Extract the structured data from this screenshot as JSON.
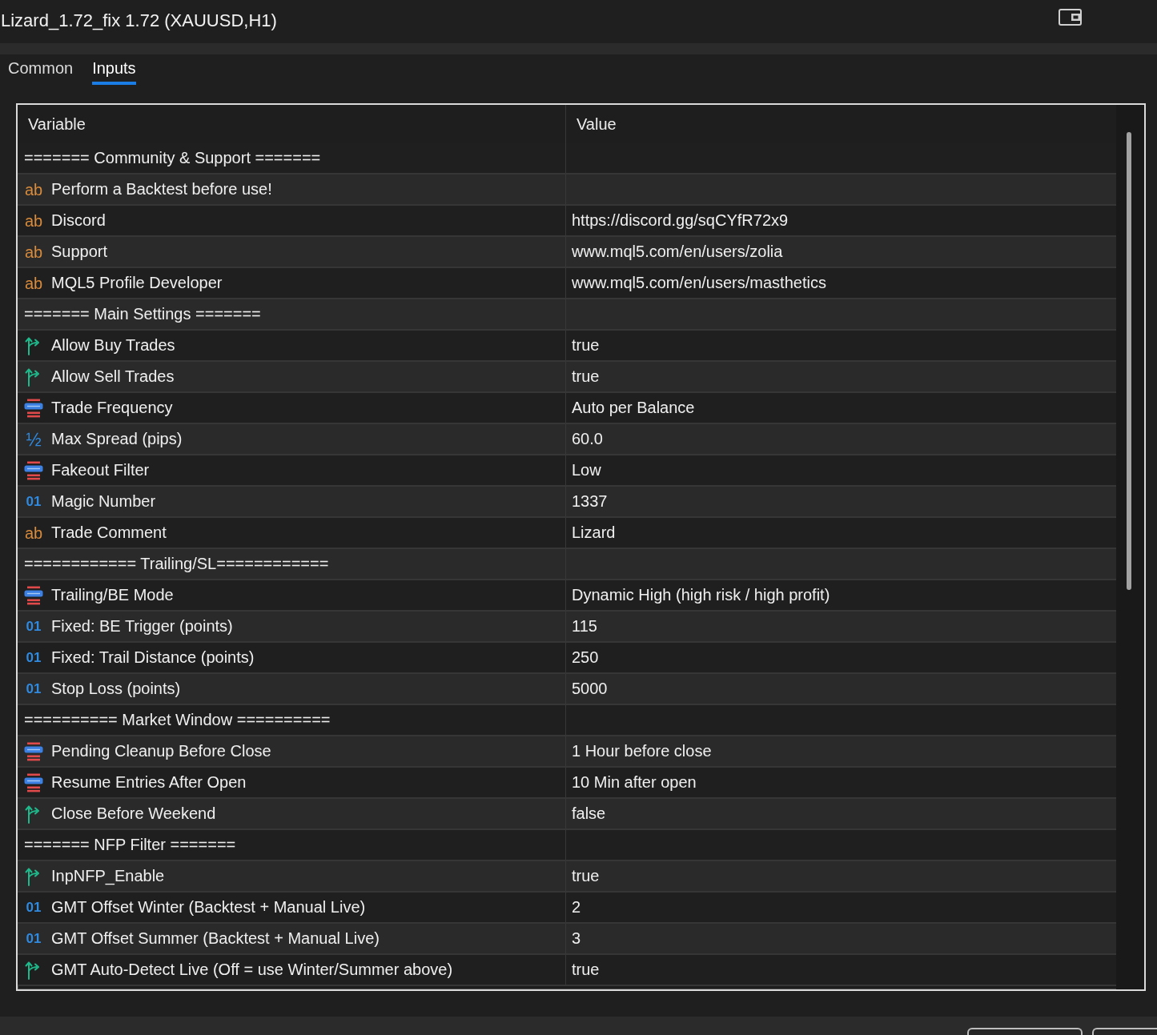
{
  "window": {
    "title": "Lizard_1.72_fix 1.72 (XAUUSD,H1)"
  },
  "tabs": [
    {
      "label": "Common",
      "selected": false
    },
    {
      "label": "Inputs",
      "selected": true
    }
  ],
  "table": {
    "columns": [
      "Variable",
      "Value"
    ],
    "rows": [
      {
        "kind": "separator",
        "variable": "======= Community & Support ======="
      },
      {
        "kind": "string",
        "icon": "ab",
        "variable": "Perform a Backtest before use!"
      },
      {
        "kind": "string",
        "icon": "ab",
        "variable": "Discord",
        "value": "https://discord.gg/sqCYfR72x9"
      },
      {
        "kind": "string",
        "icon": "ab",
        "variable": "Support",
        "value": "www.mql5.com/en/users/zolia"
      },
      {
        "kind": "string",
        "icon": "ab",
        "variable": "MQL5 Profile Developer",
        "value": "www.mql5.com/en/users/masthetics"
      },
      {
        "kind": "separator",
        "variable": "======= Main Settings ======="
      },
      {
        "kind": "bool",
        "variable": "Allow Buy Trades",
        "value": "true"
      },
      {
        "kind": "bool",
        "variable": "Allow Sell Trades",
        "value": "true"
      },
      {
        "kind": "enum",
        "variable": "Trade Frequency",
        "value": "Auto per Balance"
      },
      {
        "kind": "double",
        "icon": "½",
        "variable": "Max Spread (pips)",
        "value": "60.0"
      },
      {
        "kind": "enum",
        "variable": "Fakeout Filter",
        "value": "Low"
      },
      {
        "kind": "int",
        "icon": "01",
        "variable": "Magic Number",
        "value": "1337"
      },
      {
        "kind": "string",
        "icon": "ab",
        "variable": "Trade Comment",
        "value": "Lizard"
      },
      {
        "kind": "separator",
        "variable": "============ Trailing/SL============"
      },
      {
        "kind": "enum",
        "variable": "Trailing/BE Mode",
        "value": "Dynamic High (high risk / high profit)"
      },
      {
        "kind": "int",
        "icon": "01",
        "variable": "Fixed: BE Trigger (points)",
        "value": "115"
      },
      {
        "kind": "int",
        "icon": "01",
        "variable": "Fixed: Trail Distance (points)",
        "value": "250"
      },
      {
        "kind": "int",
        "icon": "01",
        "variable": "Stop Loss (points)",
        "value": "5000"
      },
      {
        "kind": "separator",
        "variable": "========== Market Window =========="
      },
      {
        "kind": "enum",
        "variable": "Pending Cleanup Before Close",
        "value": "1 Hour before close"
      },
      {
        "kind": "enum",
        "variable": "Resume Entries After Open",
        "value": "10 Min after open"
      },
      {
        "kind": "bool",
        "variable": "Close Before Weekend",
        "value": "false"
      },
      {
        "kind": "separator",
        "variable": "======= NFP Filter ======="
      },
      {
        "kind": "bool",
        "variable": "InpNFP_Enable",
        "value": "true"
      },
      {
        "kind": "int",
        "icon": "01",
        "variable": "GMT Offset Winter (Backtest + Manual Live)",
        "value": "2"
      },
      {
        "kind": "int",
        "icon": "01",
        "variable": "GMT Offset Summer (Backtest + Manual Live)",
        "value": "3"
      },
      {
        "kind": "bool",
        "variable": "GMT Auto-Detect Live (Off = use Winter/Summer above)",
        "value": "true"
      }
    ]
  },
  "footer": {
    "buttons": [
      {
        "kind": "button"
      },
      {
        "kind": "button"
      }
    ]
  }
}
